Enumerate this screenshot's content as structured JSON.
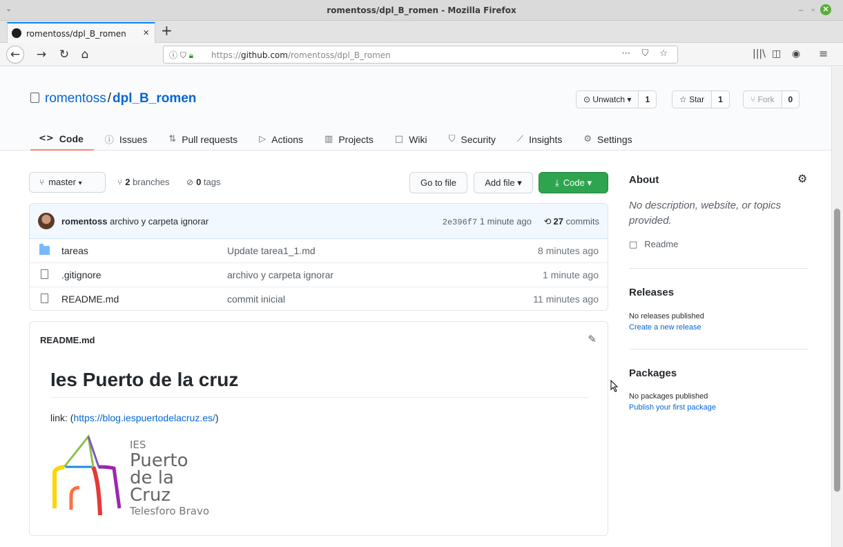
{
  "window": {
    "title": "romentoss/dpl_B_romen - Mozilla Firefox",
    "menu_glyph": "⌄",
    "btn_minimize": "–",
    "btn_restore": "▫",
    "btn_close": "✕"
  },
  "browser": {
    "tab_title": "romentoss/dpl_B_romen",
    "tab_close": "×",
    "new_tab": "+",
    "url_prefix": "https://",
    "url_host": "github.com",
    "url_path": "/romentoss/dpl_B_romen",
    "url_icons": "ⓘ ⛉",
    "url_actions": "⋯ ⛉ ☆",
    "back": "←",
    "forward": "→",
    "reload": "↻",
    "home": "⌂",
    "library": "|||\\",
    "sidebar_icon": "◫",
    "extension_icon": "◉",
    "menu": "≡"
  },
  "repo": {
    "owner": "romentoss",
    "separator": "/",
    "name": "dpl_B_romen",
    "watch": {
      "label": "⊙ Unwatch ▾",
      "count": "1"
    },
    "star": {
      "label": "☆ Star",
      "count": "1"
    },
    "fork": {
      "label": "⑂ Fork",
      "count": "0"
    }
  },
  "nav": [
    {
      "icon": "<>",
      "label": "Code"
    },
    {
      "icon": "ⓘ",
      "label": "Issues"
    },
    {
      "icon": "⇅",
      "label": "Pull requests"
    },
    {
      "icon": "▷",
      "label": "Actions"
    },
    {
      "icon": "▥",
      "label": "Projects"
    },
    {
      "icon": "□",
      "label": "Wiki"
    },
    {
      "icon": "⛉",
      "label": "Security"
    },
    {
      "icon": "⟋",
      "label": "Insights"
    },
    {
      "icon": "⚙",
      "label": "Settings"
    }
  ],
  "branch": {
    "icon": "⑂",
    "name": "master",
    "caret": "▾",
    "branches_count": "2",
    "branches_label": "branches",
    "tags_count": "0",
    "tags_label": "tags",
    "tag_icon": "⊘"
  },
  "actions": {
    "go_to_file": "Go to file",
    "add_file": "Add file ▾",
    "code": "Code ▾",
    "code_icon": "⤓"
  },
  "commit": {
    "author": "romentoss",
    "message": "archivo y carpeta ignorar",
    "sha": "2e396f7",
    "time": "1 minute ago",
    "history_icon": "⟲",
    "commits_count": "27",
    "commits_label": "commits"
  },
  "files": [
    {
      "type": "folder",
      "name": "tareas",
      "message": "Update tarea1_1.md",
      "age": "8 minutes ago"
    },
    {
      "type": "file",
      "name": ".gitignore",
      "message": "archivo y carpeta ignorar",
      "age": "1 minute ago"
    },
    {
      "type": "file",
      "name": "README.md",
      "message": "commit inicial",
      "age": "11 minutes ago"
    }
  ],
  "readme": {
    "filename": "README.md",
    "edit_icon": "✎",
    "heading": "Ies Puerto de la cruz",
    "link_prefix": "link: (",
    "link_text": "https://blog.iespuertodelacruz.es/",
    "link_suffix": ")",
    "logo": {
      "line1": "IES",
      "line2": "Puerto",
      "line3": "de la",
      "line4": "Cruz",
      "line5": "Telesforo Bravo"
    }
  },
  "sidebar": {
    "about_title": "About",
    "gear_icon": "⚙",
    "description": "No description, website, or topics provided.",
    "readme_icon": "□",
    "readme_label": "Readme",
    "releases_title": "Releases",
    "releases_none": "No releases published",
    "releases_link": "Create a new release",
    "packages_title": "Packages",
    "packages_none": "No packages published",
    "packages_link": "Publish your first package"
  },
  "colors": {
    "primary_link": "#0366d6",
    "green_button": "#2ea44f",
    "active_tab_underline": "#f9826c"
  }
}
